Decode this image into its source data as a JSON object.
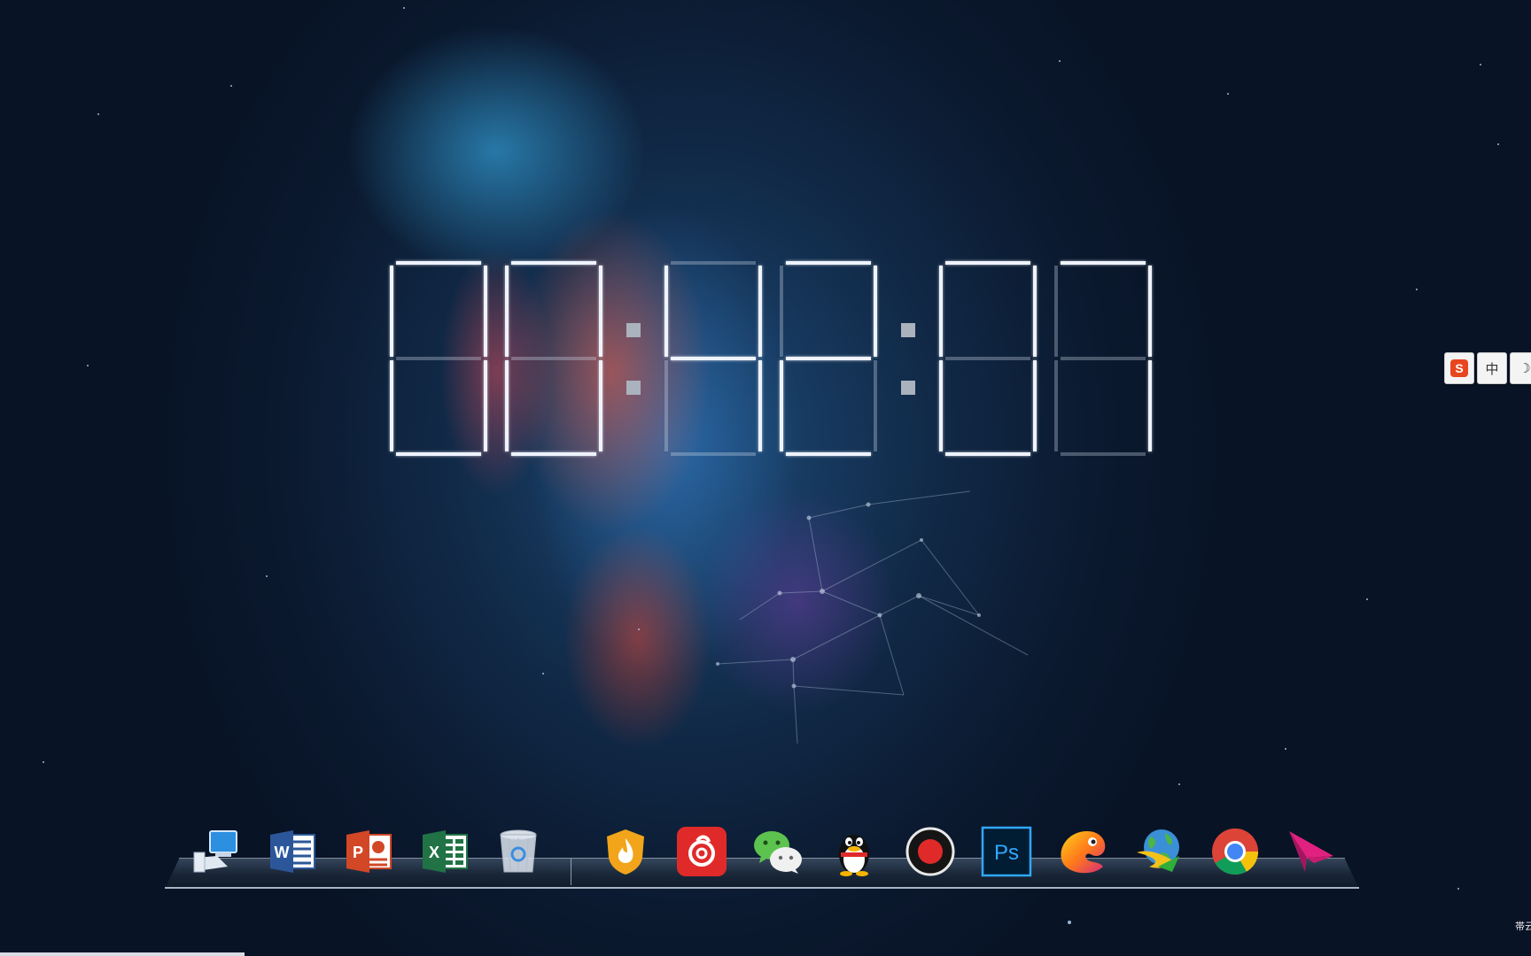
{
  "clock": {
    "time": "00:42:07",
    "hours": "00",
    "minutes": "42",
    "seconds": "07"
  },
  "ime_toolbar": {
    "logo_label": "S",
    "mode_label": "中",
    "theme_label": "☽"
  },
  "dock": {
    "items": [
      {
        "name": "this-pc",
        "icon": "computer-icon"
      },
      {
        "name": "word",
        "icon": "word-icon",
        "label": "W"
      },
      {
        "name": "powerpoint",
        "icon": "powerpoint-icon",
        "label": "P"
      },
      {
        "name": "excel",
        "icon": "excel-icon",
        "label": "X"
      },
      {
        "name": "recycle-bin",
        "icon": "recycle-bin-icon"
      },
      {
        "name": "huorong",
        "icon": "shield-flame-icon"
      },
      {
        "name": "netease-music",
        "icon": "netease-music-icon"
      },
      {
        "name": "wechat",
        "icon": "wechat-icon"
      },
      {
        "name": "qq",
        "icon": "qq-penguin-icon"
      },
      {
        "name": "screen-recorder",
        "icon": "record-icon"
      },
      {
        "name": "photoshop",
        "icon": "photoshop-icon",
        "label": "Ps"
      },
      {
        "name": "unknown-chameleon",
        "icon": "chameleon-icon"
      },
      {
        "name": "download-manager",
        "icon": "globe-download-icon"
      },
      {
        "name": "chrome",
        "icon": "chrome-icon"
      },
      {
        "name": "send-arrow",
        "icon": "paper-plane-icon"
      }
    ]
  },
  "corner_text": "帯云",
  "colors": {
    "accent_red": "#e02a2a",
    "word_blue": "#2b579a",
    "ppt_orange": "#d24726",
    "excel_green": "#217346",
    "ps_blue": "#31a8ff"
  }
}
